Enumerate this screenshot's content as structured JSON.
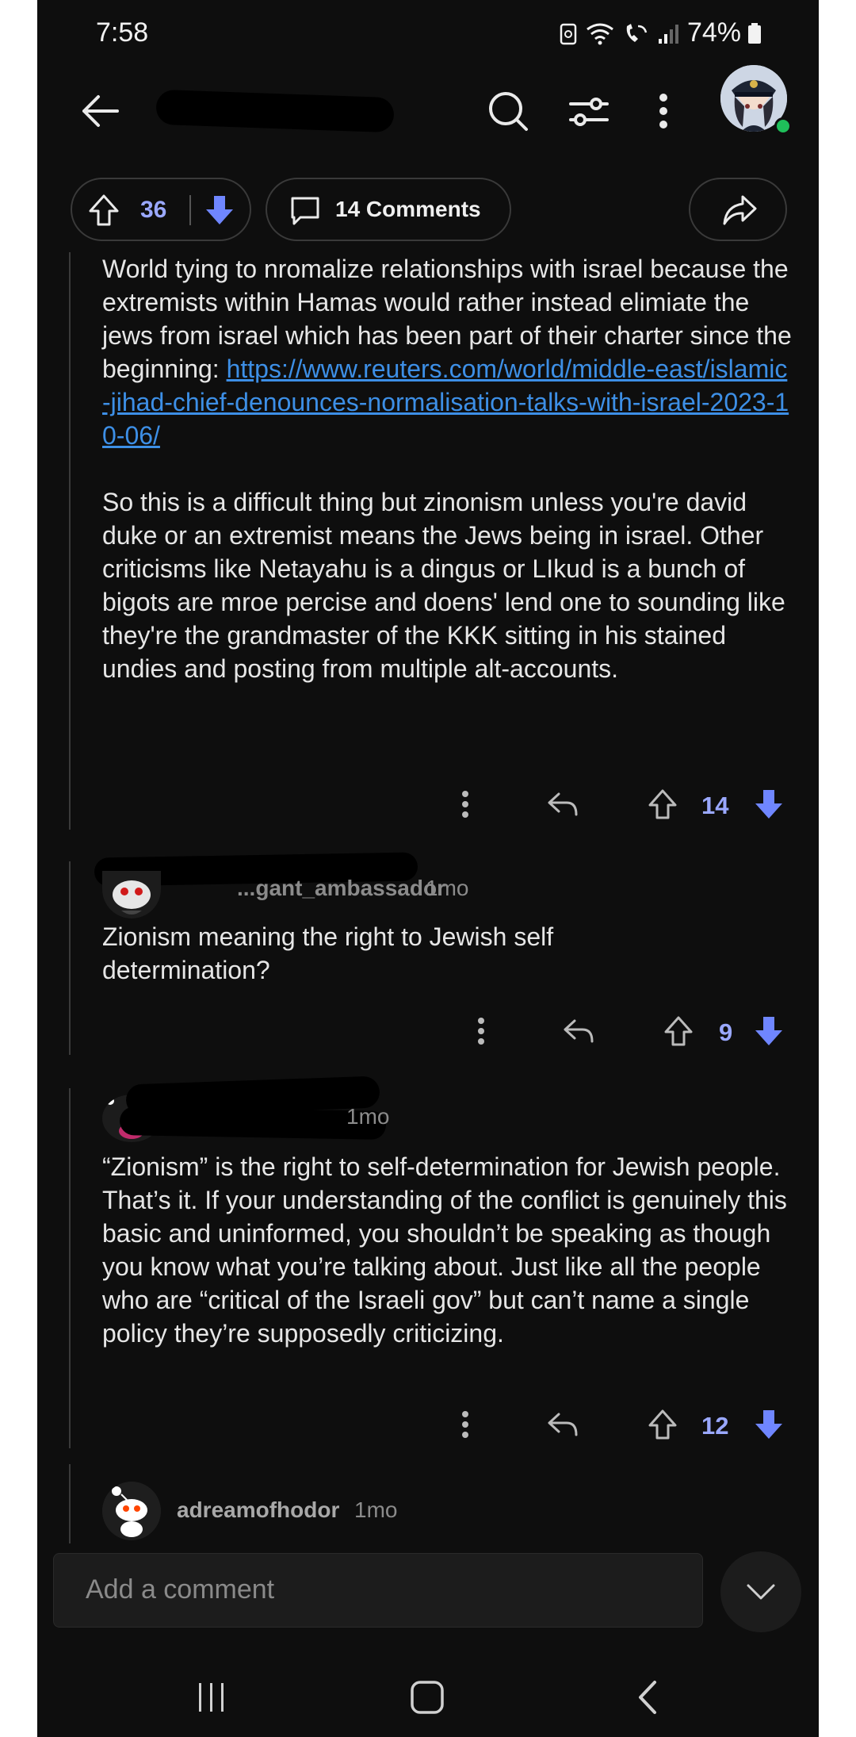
{
  "status": {
    "time": "7:58",
    "battery": "74%"
  },
  "post_bar": {
    "upvotes": "36",
    "comments_label": "14 Comments"
  },
  "comments": [
    {
      "text_a": "World tying to nromalize relationships with israel because the extremists within Hamas would rather instead elimiate the jews from israel which has been part of their charter since the beginning: ",
      "link": "https://www.reuters.com/world/middle-east/islamic-jihad-chief-denounces-normalisation-talks-with-israel-2023-10-06/",
      "text_b": "So this is a difficult thing but zinonism unless you're david duke or an extremist means the Jews being in israel. Other criticisms like Netayahu is a dingus or LIkud is a bunch of bigots are mroe percise and doens' lend one to sounding like they're the grandmaster of the KKK sitting in his stained undies and posting from multiple alt-accounts.",
      "score": "14"
    },
    {
      "author": "...gant_ambassador",
      "age": "1mo",
      "text": "Zionism meaning the right to Jewish self determination?",
      "score": "9"
    },
    {
      "author": "",
      "age": "1mo",
      "text": "“Zionism” is the right to self-determination for Jewish people. That’s it. If your understanding of the conflict is genuinely this basic and uninformed, you shouldn’t be speaking as though you know what you’re talking about. Just like all the people who are “critical of the Israeli gov” but can’t name a single policy they’re supposedly criticizing.",
      "score": "12"
    },
    {
      "author": "adreamofhodor",
      "age": "1mo"
    }
  ],
  "composer": {
    "placeholder": "Add a comment"
  },
  "colors": {
    "upvote_accent": "#9aa8ff",
    "downvote": "#6f86ff",
    "link": "#3d8fe6",
    "background": "#0e0e0e"
  }
}
